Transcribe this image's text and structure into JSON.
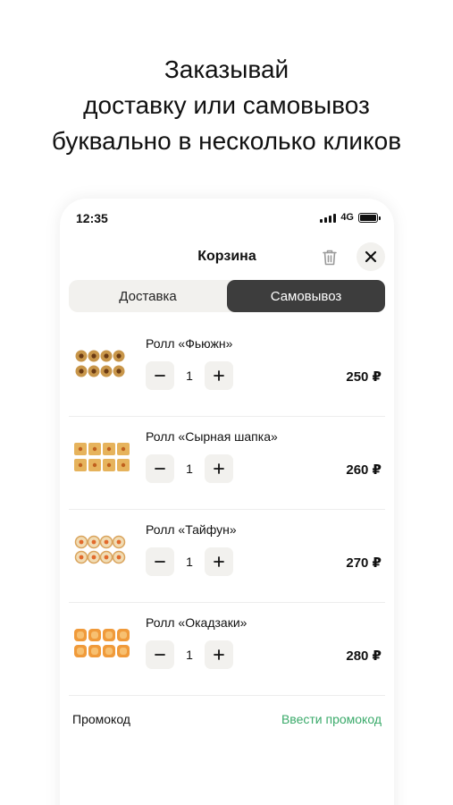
{
  "headline": {
    "line1": "Заказывай",
    "line2": "доставку или самовывоз",
    "line3": "буквально в несколько кликов"
  },
  "status_bar": {
    "time": "12:35",
    "network": "4G",
    "battery_level": 1.0
  },
  "header": {
    "title": "Корзина",
    "trash_icon": "trash-icon",
    "close_icon": "close-icon"
  },
  "tabs": [
    {
      "label": "Доставка",
      "active": false
    },
    {
      "label": "Самовывоз",
      "active": true
    }
  ],
  "items": [
    {
      "name": "Ролл «Фьюжн»",
      "qty": "1",
      "price": "250 ₽"
    },
    {
      "name": "Ролл «Сырная шапка»",
      "qty": "1",
      "price": "260 ₽"
    },
    {
      "name": "Ролл «Тайфун»",
      "qty": "1",
      "price": "270 ₽"
    },
    {
      "name": "Ролл «Окадзаки»",
      "qty": "1",
      "price": "280 ₽"
    }
  ],
  "promo": {
    "label": "Промокод",
    "link": "Ввести промокод"
  },
  "colors": {
    "accent_green": "#3aaa6a",
    "tab_active": "#3d3d3d",
    "chip_bg": "#f2f1ee"
  }
}
